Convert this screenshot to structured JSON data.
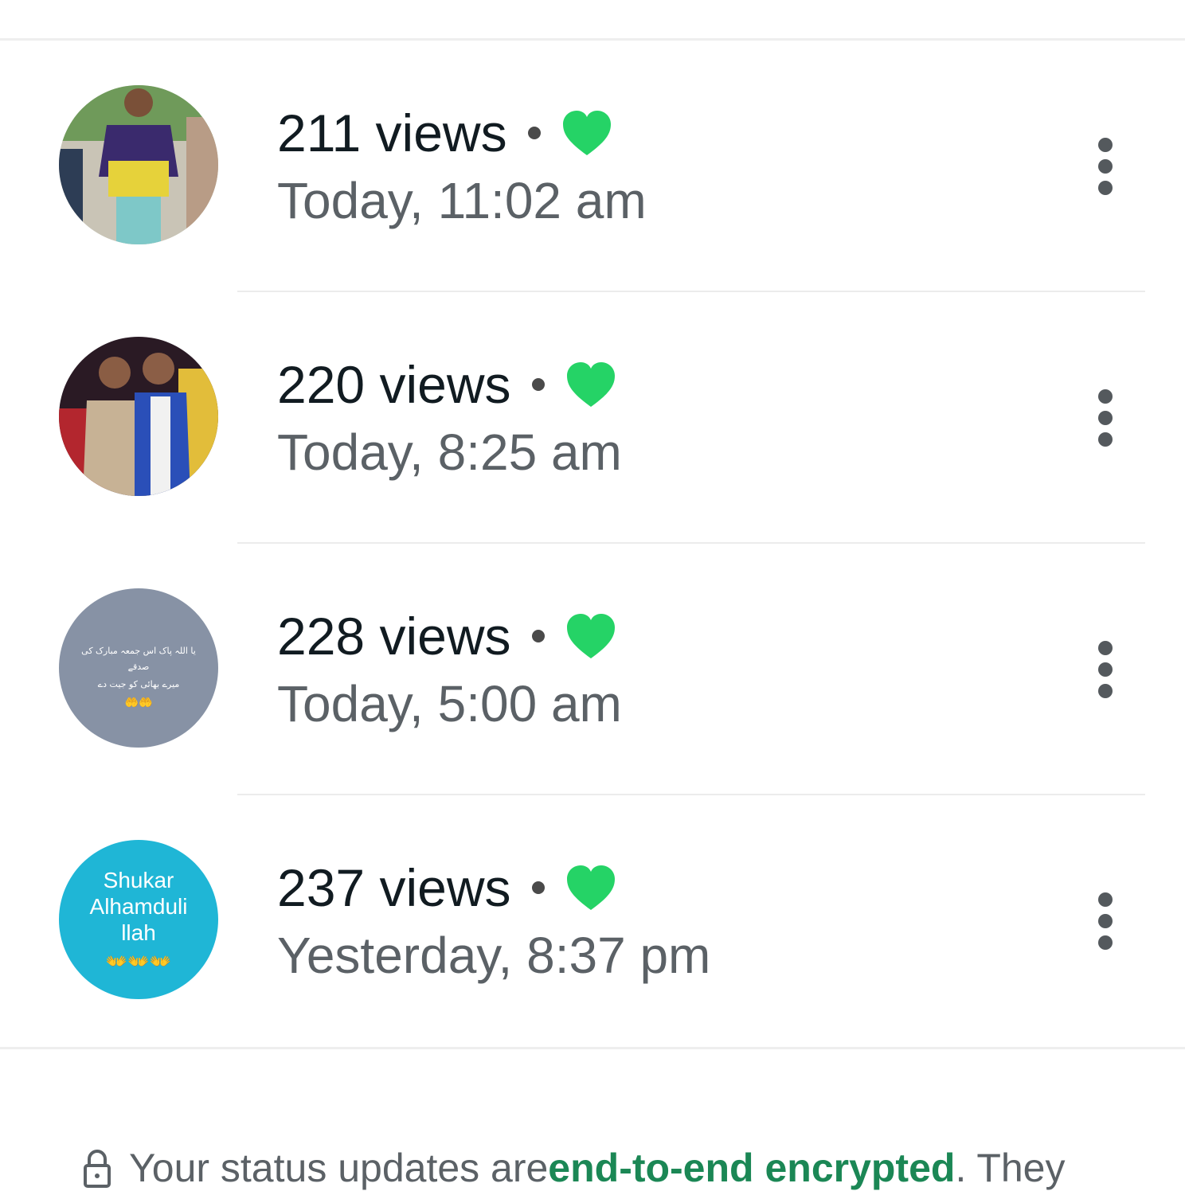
{
  "colors": {
    "heart": "#25d366",
    "link": "#1b8755",
    "text_primary": "#111b21",
    "text_secondary": "#5b6166"
  },
  "statuses": [
    {
      "views": "211 views",
      "reaction": "green-heart",
      "time": "Today, 11:02 am",
      "thumbnail": "photo-man-in-sports-jersey"
    },
    {
      "views": "220 views",
      "reaction": "green-heart",
      "time": "Today, 8:25 am",
      "thumbnail": "photo-two-men-posing"
    },
    {
      "views": "228 views",
      "reaction": "green-heart",
      "time": "Today, 5:00 am",
      "thumbnail": "text-status-grey",
      "thumb_text": [
        "یا اللہ پاک اس جمعہ مبارک کی",
        "صدقے",
        "میرے بھائی کو جیت دے",
        "🤲🤲"
      ]
    },
    {
      "views": "237 views",
      "reaction": "green-heart",
      "time": "Yesterday, 8:37 pm",
      "thumbnail": "text-status-blue",
      "thumb_text": [
        "Shukar",
        "Alhamduli",
        "llah",
        "👐👐👐"
      ]
    }
  ],
  "footer": {
    "icon": "lock-icon",
    "text_before": "Your status updates are ",
    "link_text": "end-to-end encrypted",
    "text_after": ". They"
  }
}
